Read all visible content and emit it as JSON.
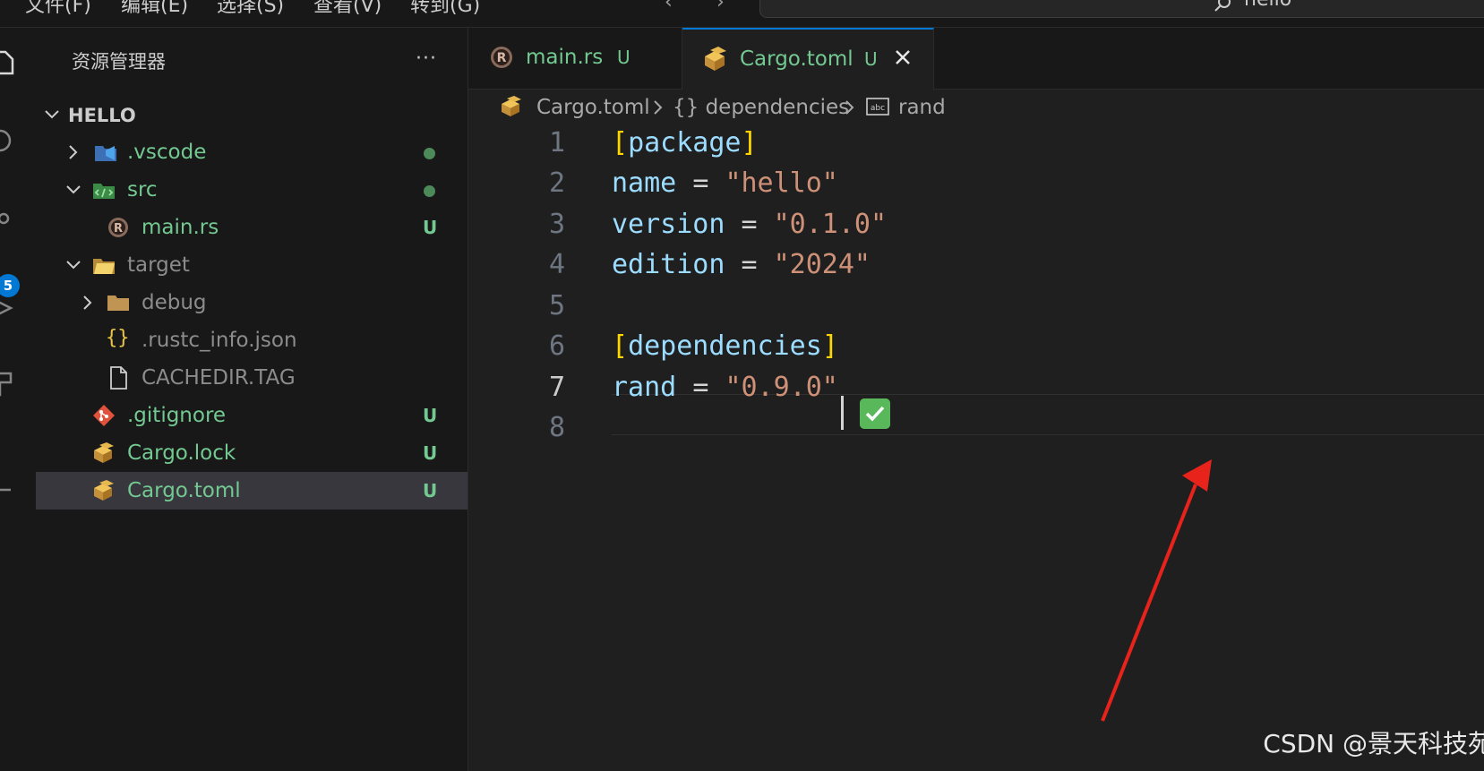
{
  "menubar": {
    "items": [
      "文件(F)",
      "编辑(E)",
      "选择(S)",
      "查看(V)",
      "转到(G)"
    ],
    "search_text": "hello"
  },
  "activity_bar": {
    "icons": [
      "explorer-icon",
      "search-icon",
      "source-control-icon",
      "run-debug-icon",
      "extensions-icon",
      "test-icon"
    ],
    "source_control_badge": "5"
  },
  "sidebar": {
    "title": "资源管理器",
    "more_label": "···",
    "root": "HELLO",
    "items": [
      {
        "name": ".vscode",
        "color": "#73c991",
        "status": "dot",
        "icon": "vscode-folder-icon"
      },
      {
        "name": "src",
        "color": "#73c991",
        "status": "dot",
        "icon": "src-folder-icon"
      },
      {
        "name": "main.rs",
        "color": "#73c991",
        "status": "U",
        "icon": "rust-file-icon"
      },
      {
        "name": "target",
        "color": "#8c8c8c",
        "status": "",
        "icon": "target-folder-icon"
      },
      {
        "name": "debug",
        "color": "#8c8c8c",
        "status": "",
        "icon": "folder-icon"
      },
      {
        "name": ".rustc_info.json",
        "color": "#8c8c8c",
        "status": "",
        "icon": "json-icon"
      },
      {
        "name": "CACHEDIR.TAG",
        "color": "#8c8c8c",
        "status": "",
        "icon": "file-icon"
      },
      {
        "name": ".gitignore",
        "color": "#73c991",
        "status": "U",
        "icon": "git-icon"
      },
      {
        "name": "Cargo.lock",
        "color": "#73c991",
        "status": "U",
        "icon": "cargo-icon"
      },
      {
        "name": "Cargo.toml",
        "color": "#73c991",
        "status": "U",
        "icon": "cargo-icon"
      }
    ]
  },
  "tabs": [
    {
      "label": "main.rs",
      "status": "U",
      "active": false
    },
    {
      "label": "Cargo.toml",
      "status": "U",
      "active": true,
      "close": "close-icon"
    }
  ],
  "breadcrumb": {
    "file": "Cargo.toml",
    "section": "{} dependencies",
    "item": "rand"
  },
  "editor": {
    "line_numbers": [
      "1",
      "2",
      "3",
      "4",
      "5",
      "6",
      "7",
      "8"
    ],
    "current_line": "7",
    "lines": {
      "l1_table": "package",
      "l2_key": "name",
      "l2_val": "\"hello\"",
      "l3_key": "version",
      "l3_val": "\"0.1.0\"",
      "l4_key": "edition",
      "l4_val": "\"2024\"",
      "l6_table": "dependencies",
      "l7_key": "rand",
      "l7_val": "\"0.9.0\""
    },
    "equals": "=",
    "bracket_open": "[",
    "bracket_close": "]"
  },
  "watermark": "CSDN @景天科技苑",
  "colors": {
    "accent": "#0078d4",
    "git_untracked": "#73c991",
    "annotation_arrow": "#e8231b",
    "check_badge": "#58b85a"
  }
}
